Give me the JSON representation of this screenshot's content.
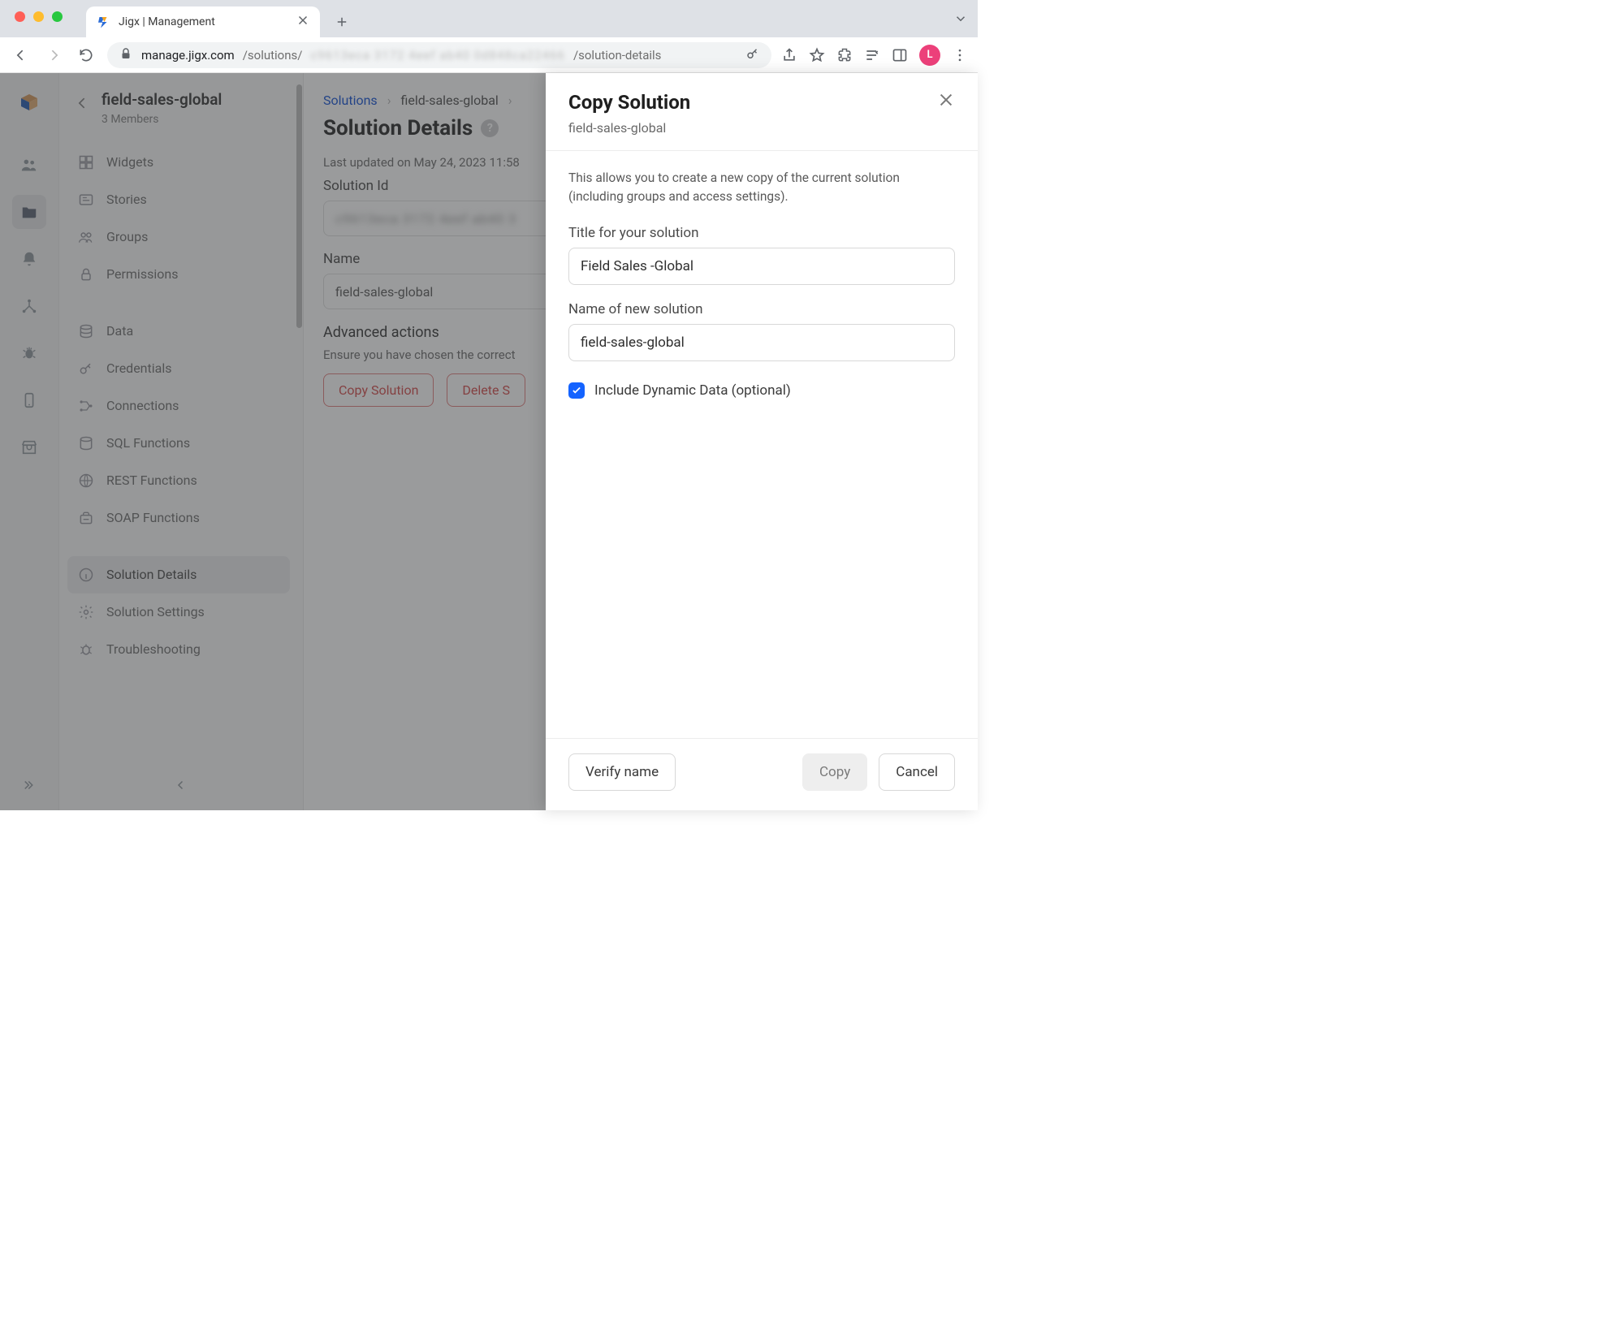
{
  "browser": {
    "tab_title": "Jigx | Management",
    "url_host": "manage.jigx.com",
    "url_path_prefix": "/solutions/",
    "url_path_suffix": "/solution-details",
    "url_obscured_segment": "c9613eca 3172 4eef ab40 0d848ca22466",
    "avatar_initial": "L"
  },
  "sidebar": {
    "title": "field-sales-global",
    "subtitle": "3 Members",
    "items": [
      {
        "label": "Widgets",
        "icon": "widgets"
      },
      {
        "label": "Stories",
        "icon": "stories"
      },
      {
        "label": "Groups",
        "icon": "groups"
      },
      {
        "label": "Permissions",
        "icon": "permissions"
      },
      {
        "label": "Data",
        "icon": "data"
      },
      {
        "label": "Credentials",
        "icon": "credentials"
      },
      {
        "label": "Connections",
        "icon": "connections"
      },
      {
        "label": "SQL Functions",
        "icon": "sql"
      },
      {
        "label": "REST Functions",
        "icon": "rest"
      },
      {
        "label": "SOAP Functions",
        "icon": "soap"
      },
      {
        "label": "Solution Details",
        "icon": "info",
        "selected": true
      },
      {
        "label": "Solution Settings",
        "icon": "settings"
      },
      {
        "label": "Troubleshooting",
        "icon": "troubleshoot"
      }
    ]
  },
  "breadcrumbs": {
    "root": "Solutions",
    "second": "field-sales-global"
  },
  "page": {
    "title": "Solution Details",
    "last_updated": "Last updated on May 24, 2023 11:58",
    "fields": {
      "solution_id_label": "Solution Id",
      "solution_id_value_obscured": "c9613eca 3172 4eef ab40 3",
      "name_label": "Name",
      "name_value": "field-sales-global"
    },
    "advanced": {
      "title": "Advanced actions",
      "desc": "Ensure you have chosen the correct",
      "copy_btn": "Copy Solution",
      "delete_btn": "Delete S"
    }
  },
  "modal": {
    "title": "Copy Solution",
    "subtitle": "field-sales-global",
    "description": "This allows you to create a new copy of the current solution (including groups and access settings).",
    "title_input_label": "Title for your solution",
    "title_input_value": "Field Sales -Global",
    "name_input_label": "Name of new solution",
    "name_input_value": "field-sales-global",
    "include_dd_label": "Include Dynamic Data (optional)",
    "include_dd_checked": true,
    "footer": {
      "verify": "Verify name",
      "copy": "Copy",
      "cancel": "Cancel"
    }
  }
}
